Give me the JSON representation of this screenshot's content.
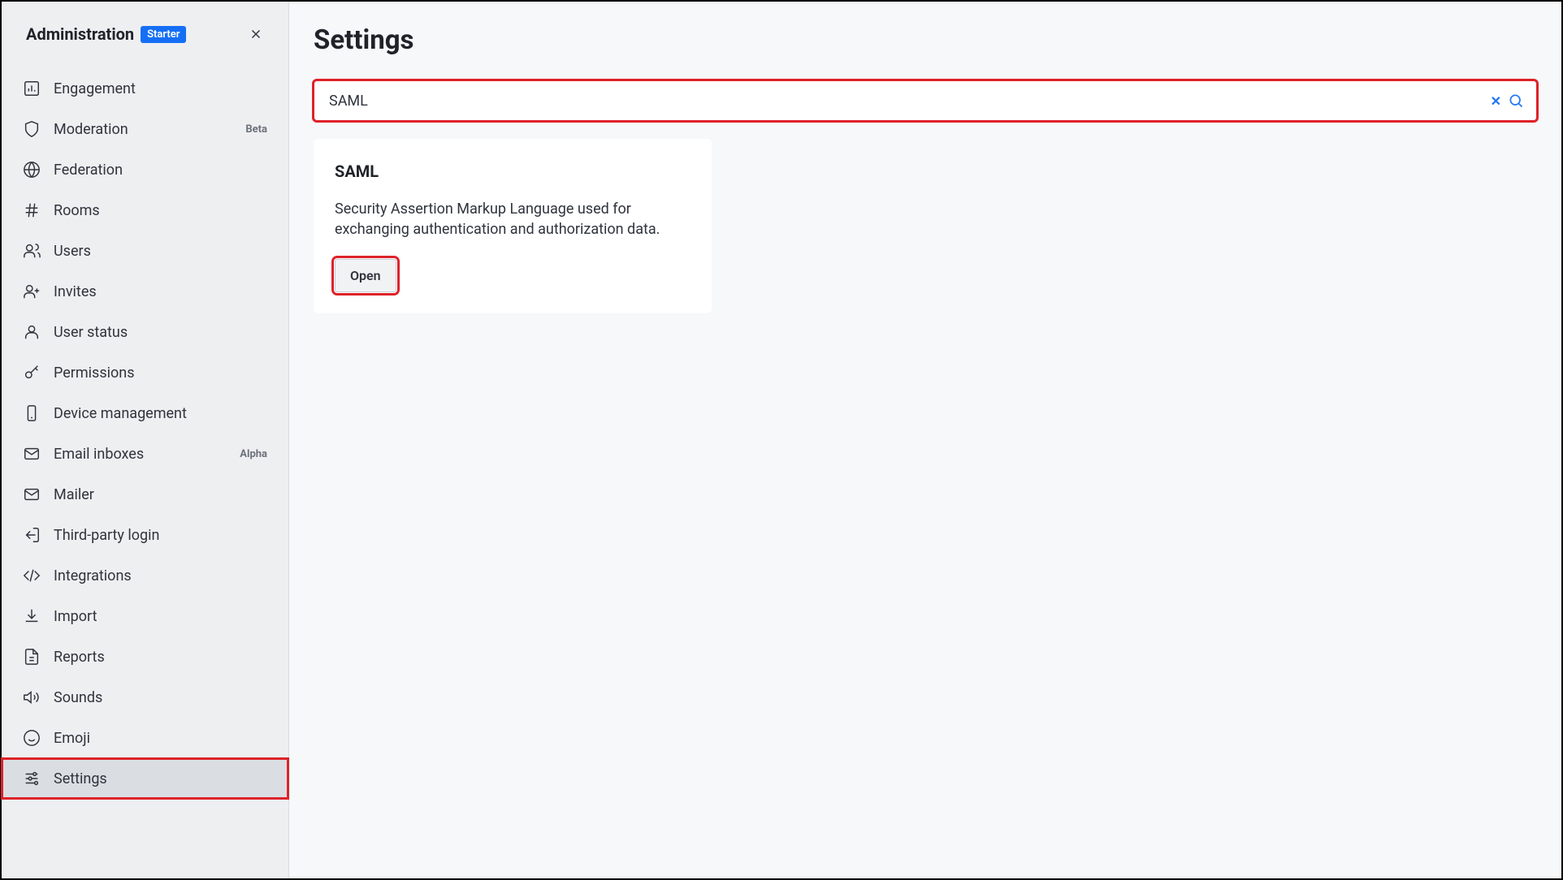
{
  "sidebar": {
    "title": "Administration",
    "badge": "Starter",
    "items": [
      {
        "icon": "bar-chart",
        "label": "Engagement",
        "tag": ""
      },
      {
        "icon": "shield",
        "label": "Moderation",
        "tag": "Beta"
      },
      {
        "icon": "globe",
        "label": "Federation",
        "tag": ""
      },
      {
        "icon": "hash",
        "label": "Rooms",
        "tag": ""
      },
      {
        "icon": "users",
        "label": "Users",
        "tag": ""
      },
      {
        "icon": "user-plus",
        "label": "Invites",
        "tag": ""
      },
      {
        "icon": "user",
        "label": "User status",
        "tag": ""
      },
      {
        "icon": "key",
        "label": "Permissions",
        "tag": ""
      },
      {
        "icon": "phone",
        "label": "Device management",
        "tag": ""
      },
      {
        "icon": "inbox",
        "label": "Email inboxes",
        "tag": "Alpha"
      },
      {
        "icon": "mail",
        "label": "Mailer",
        "tag": ""
      },
      {
        "icon": "login",
        "label": "Third-party login",
        "tag": ""
      },
      {
        "icon": "code",
        "label": "Integrations",
        "tag": ""
      },
      {
        "icon": "download",
        "label": "Import",
        "tag": ""
      },
      {
        "icon": "file",
        "label": "Reports",
        "tag": ""
      },
      {
        "icon": "speaker",
        "label": "Sounds",
        "tag": ""
      },
      {
        "icon": "smile",
        "label": "Emoji",
        "tag": ""
      },
      {
        "icon": "sliders",
        "label": "Settings",
        "tag": ""
      }
    ]
  },
  "main": {
    "title": "Settings",
    "search_value": "SAML",
    "card": {
      "title": "SAML",
      "description": "Security Assertion Markup Language used for exchanging authentication and authorization data.",
      "open_label": "Open"
    }
  }
}
